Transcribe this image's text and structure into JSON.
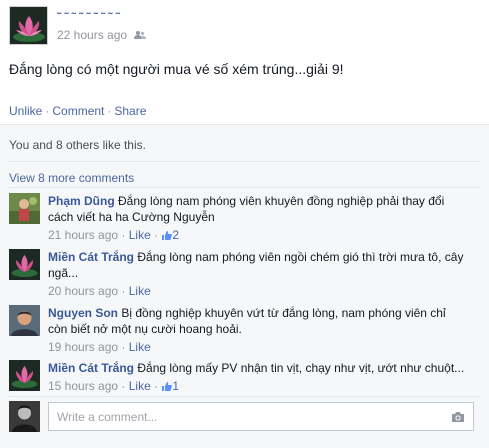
{
  "post": {
    "author_name": "˜ ˜ ˜ ˜ ˜ ˜ ˜ ˜ ˜",
    "timestamp": "22 hours ago",
    "text": "Đắng lòng có một người mua vé số xém trúng...giải 9!"
  },
  "actions": {
    "unlike": "Unlike",
    "comment": "Comment",
    "share": "Share",
    "separator": "·"
  },
  "likes_summary": "You and 8 others like this.",
  "view_more": "View 8 more comments",
  "comments": [
    {
      "author": "Phạm Dũng",
      "text": "Đắng lòng nam phóng viên khuyên đồng nghiệp phải thay đổi cách viết ha ha Cường Nguyễn",
      "time": "21 hours ago",
      "like": "Like",
      "like_count": "2"
    },
    {
      "author": "Miền Cát Trắng",
      "text": "Đắng lòng nam phóng viên ngồi chém gió thì trời mưa tô, cây ngã...",
      "time": "20 hours ago",
      "like": "Like",
      "like_count": ""
    },
    {
      "author": "Nguyen Son",
      "text": "Bị đồng nghiệp khuyên vứt từ đắng lòng, nam phóng viên chỉ còn biết nở một nụ cười hoang hoải.",
      "time": "19 hours ago",
      "like": "Like",
      "like_count": ""
    },
    {
      "author": "Miền Cát Trắng",
      "text": "Đắng lòng mấy PV nhận tin vịt, chạy như vịt, ướt như chuột...",
      "time": "15 hours ago",
      "like": "Like",
      "like_count": "1"
    }
  ],
  "composer": {
    "placeholder": "Write a comment..."
  },
  "colors": {
    "link": "#3b5998",
    "meta": "#90949c",
    "background": "#f6f7f9"
  },
  "icons": [
    "friends-icon",
    "thumbs-up-icon",
    "camera-icon"
  ]
}
